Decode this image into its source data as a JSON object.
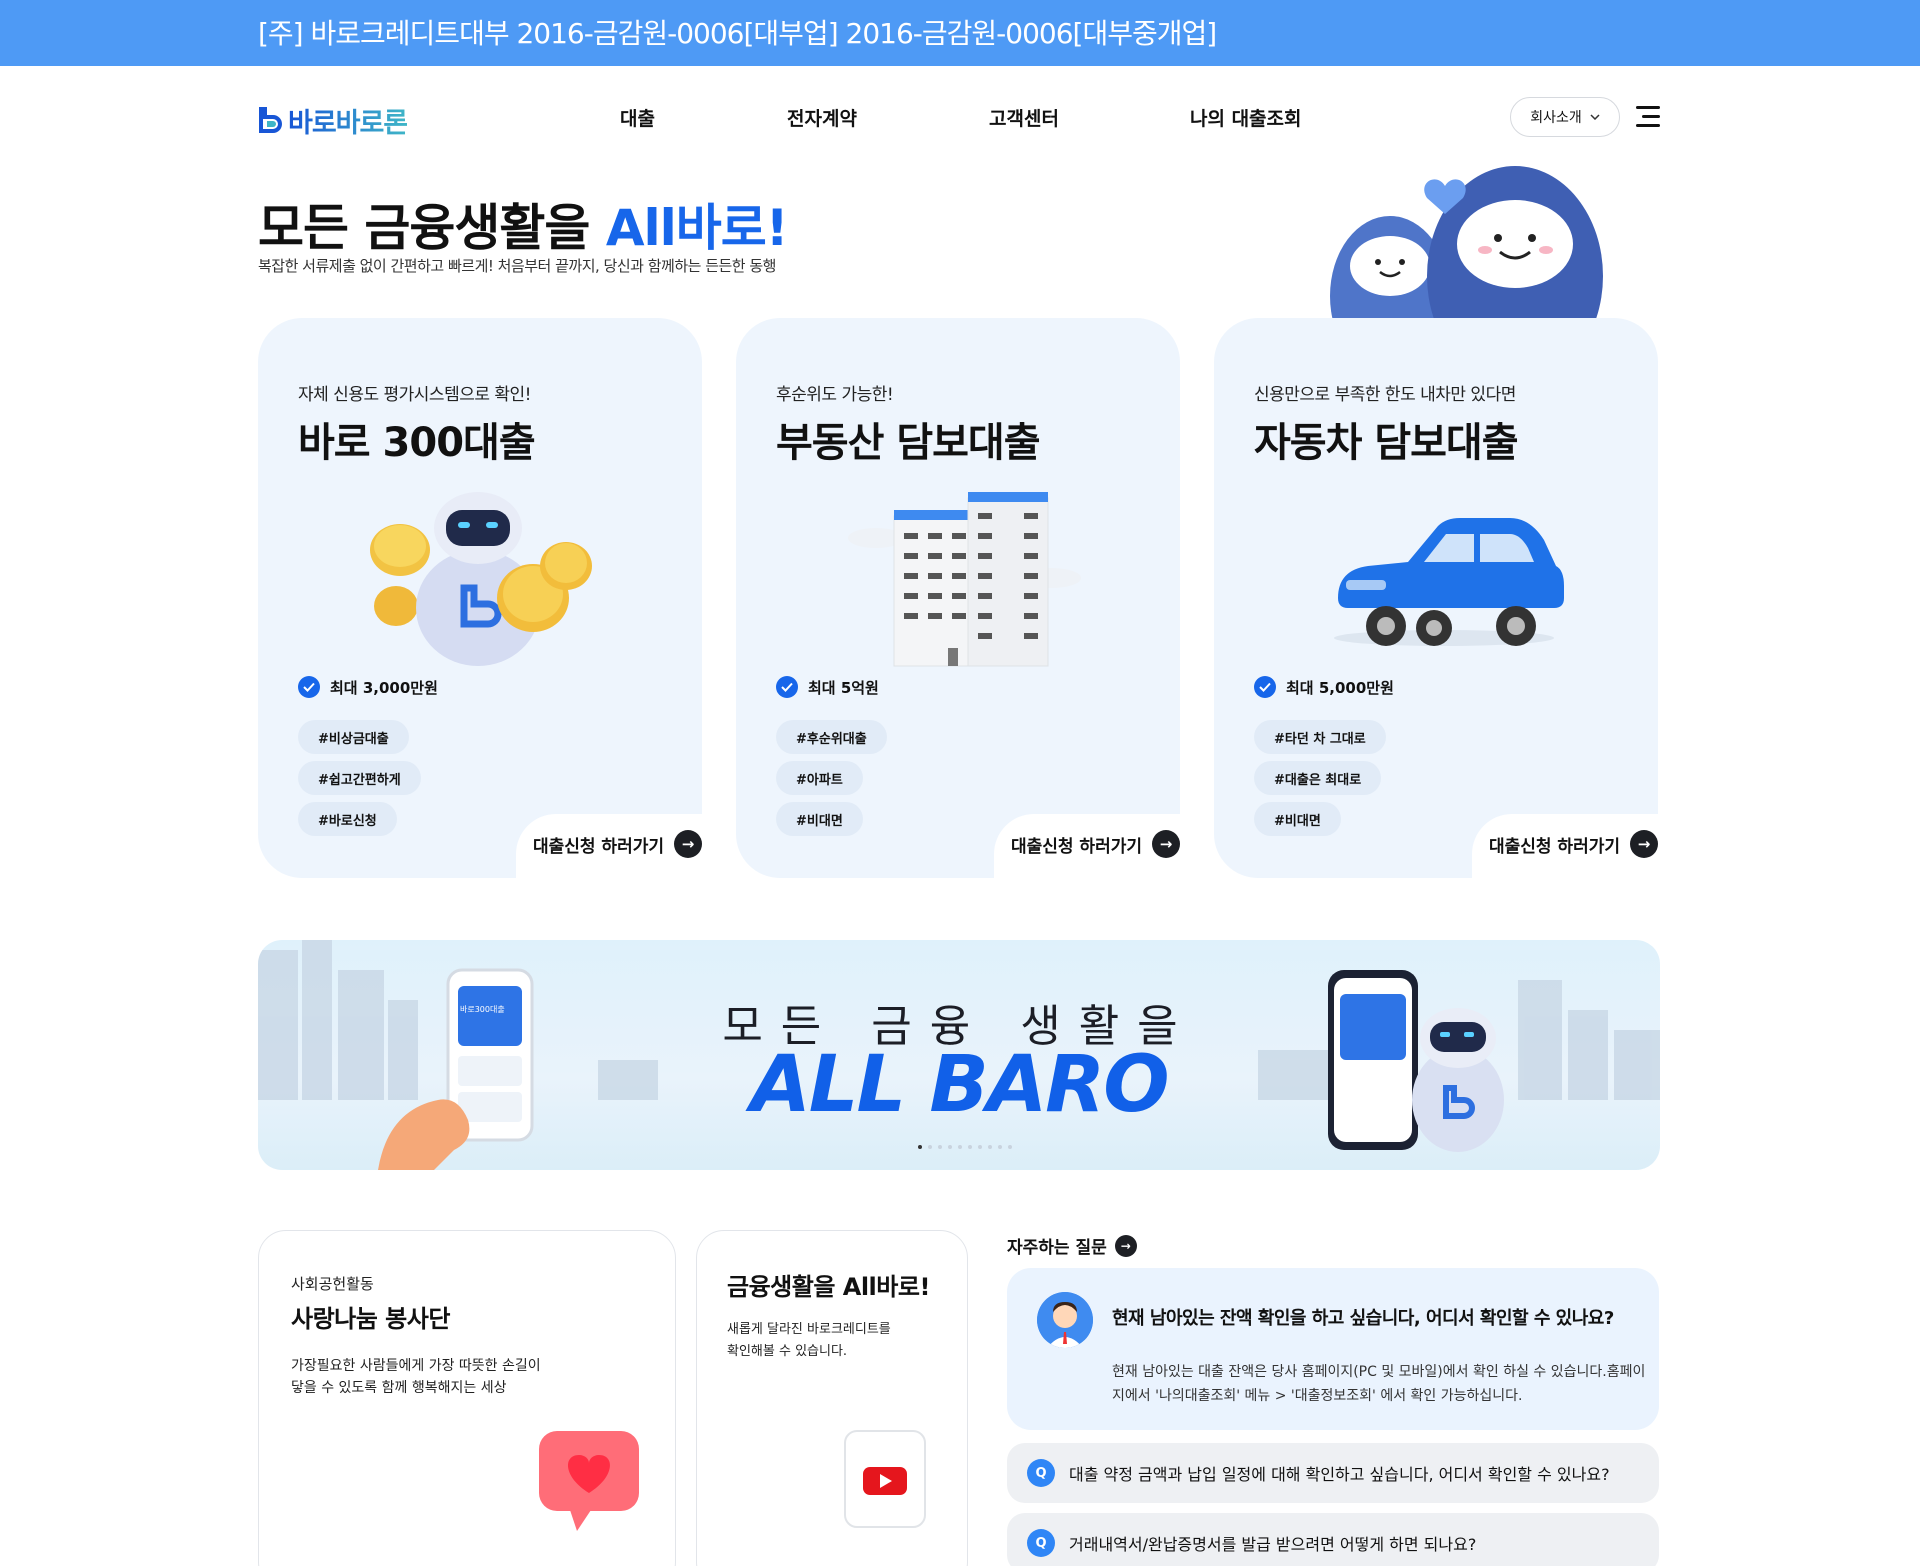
{
  "topbar": {
    "text": "[주] 바로크레디트대부 2016-금감원-0006[대부업] 2016-금감원-0006[대부중개업]"
  },
  "header": {
    "logo_text": "바로바로론",
    "nav": [
      "대출",
      "전자계약",
      "고객센터",
      "나의 대출조회"
    ],
    "about_label": "회사소개"
  },
  "hero": {
    "title_main": "모든 금융생활을 ",
    "title_accent": "All바로!",
    "subtitle": "복잡한 서류제출 없이 간편하고 빠르게! 처음부터 끝까지, 당신과 함께하는 든든한 동행"
  },
  "cards": [
    {
      "sub": "자체 신용도 평가시스템으로 확인!",
      "title": "바로 300대출",
      "max": "최대 3,000만원",
      "tags": [
        "#비상금대출",
        "#쉽고간편하게",
        "#바로신청"
      ],
      "link": "대출신청 하러가기"
    },
    {
      "sub": "후순위도 가능한!",
      "title": "부동산 담보대출",
      "max": "최대 5억원",
      "tags": [
        "#후순위대출",
        "#아파트",
        "#비대면"
      ],
      "link": "대출신청 하러가기"
    },
    {
      "sub": "신용만으로 부족한 한도 내차만 있다면",
      "title": "자동차 담보대출",
      "max": "최대 5,000만원",
      "tags": [
        "#타던 차 그대로",
        "#대출은 최대로",
        "#비대면"
      ],
      "link": "대출신청 하러가기"
    }
  ],
  "banner": {
    "line1": "모든 금융 생활을",
    "line2": "ALL BARO",
    "phone_text": "바로300대출"
  },
  "volunteer": {
    "small": "사회공헌활동",
    "title": "사랑나눔 봉사단",
    "desc1": "가장필요한 사람들에게 가장 따뜻한 손길이",
    "desc2": "닿을 수 있도록 함께 행복해지는 세상"
  },
  "youtube": {
    "title": "금융생활을 All바로!",
    "desc1": "새롭게 달라진 바로크레디트를",
    "desc2": "확인해볼 수 있습니다."
  },
  "faq": {
    "heading": "자주하는 질문",
    "open_q": "현재 남아있는 잔액 확인을 하고 싶습니다, 어디서 확인할 수 있나요?",
    "open_a1": "현재 남아있는 대출 잔액은 당사 홈페이지(PC 및 모바일)에서 확인 하실 수 있습니다.홈페이",
    "open_a2": "지에서 '나의대출조회' 메뉴 > '대출정보조회' 에서 확인 가능하십니다.",
    "q_badge": "Q",
    "items": [
      "대출 약정 금액과 납입 일정에 대해 확인하고 싶습니다, 어디서 확인할 수 있나요?",
      "거래내역서/완납증명서를 발급 받으려면 어떻게 하면 되나요?"
    ]
  },
  "colors": {
    "topbar": "#4e9af5",
    "accent": "#1766ea",
    "card_bg": "#eef5fd",
    "faq_bg": "#eaf3fe"
  }
}
